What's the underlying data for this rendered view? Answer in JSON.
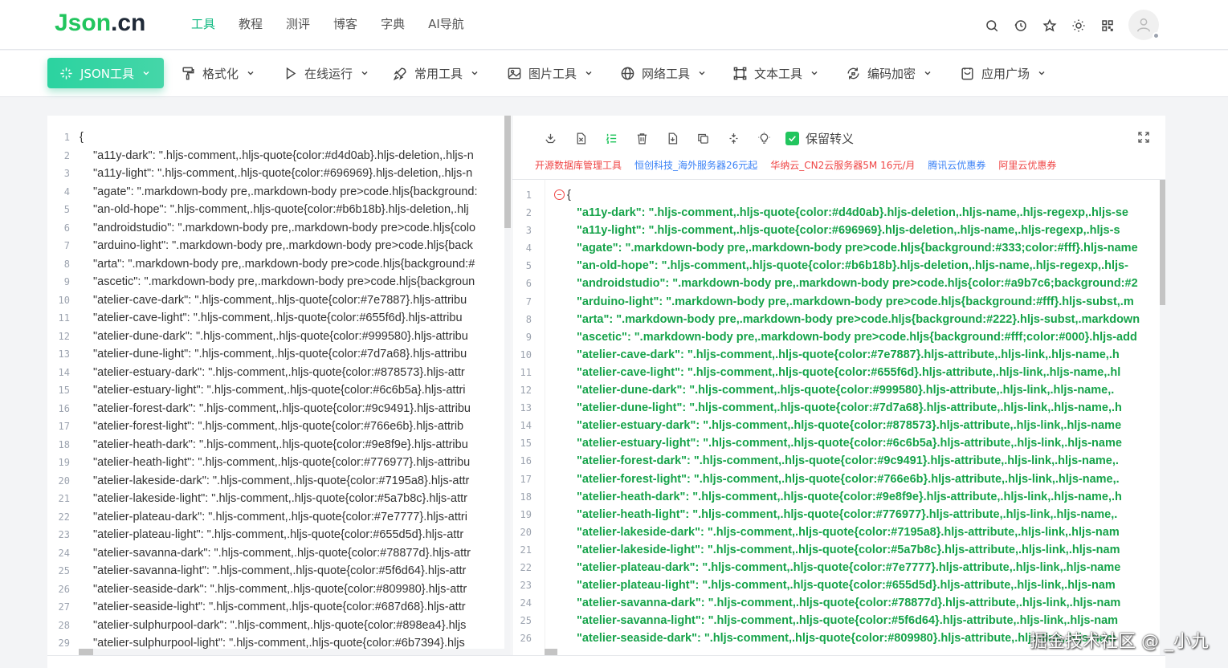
{
  "logo": {
    "part1": "Json",
    "part2": ".cn"
  },
  "nav": [
    {
      "label": "工具",
      "active": true
    },
    {
      "label": "教程",
      "active": false
    },
    {
      "label": "测评",
      "active": false
    },
    {
      "label": "博客",
      "active": false
    },
    {
      "label": "字典",
      "active": false
    },
    {
      "label": "AI导航",
      "active": false
    }
  ],
  "header_icons": [
    "search-icon",
    "history-icon",
    "star-icon",
    "sun-icon",
    "qrcode-icon"
  ],
  "toolbar": [
    {
      "label": "JSON工具",
      "icon": "sparkle-icon",
      "primary": true
    },
    {
      "label": "格式化",
      "icon": "paint-roller-icon"
    },
    {
      "label": "在线运行",
      "icon": "play-icon"
    },
    {
      "label": "常用工具",
      "icon": "rocket-icon"
    },
    {
      "label": "图片工具",
      "icon": "image-icon"
    },
    {
      "label": "网络工具",
      "icon": "globe-icon"
    },
    {
      "label": "文本工具",
      "icon": "frame-icon"
    },
    {
      "label": "编码加密",
      "icon": "refresh-lock-icon"
    },
    {
      "label": "应用广场",
      "icon": "app-icon"
    }
  ],
  "right_panel": {
    "keep_escape_label": "保留转义",
    "ads": [
      {
        "label": "开源数据库管理工具",
        "color": "red"
      },
      {
        "label": "恒创科技_海外服务器26元起",
        "color": "blue"
      },
      {
        "label": "华纳云_CN2云服务器5M 16元/月",
        "color": "red"
      },
      {
        "label": "腾讯云优惠券",
        "color": "blue"
      },
      {
        "label": "阿里云优惠券",
        "color": "red"
      }
    ]
  },
  "left_lines": [
    "{",
    "\"a11y-dark\": \".hljs-comment,.hljs-quote{color:#d4d0ab}.hljs-deletion,.hljs-n",
    "\"a11y-light\": \".hljs-comment,.hljs-quote{color:#696969}.hljs-deletion,.hljs-n",
    "\"agate\": \".markdown-body pre,.markdown-body pre>code.hljs{background:",
    "\"an-old-hope\": \".hljs-comment,.hljs-quote{color:#b6b18b}.hljs-deletion,.hlj",
    "\"androidstudio\": \".markdown-body pre,.markdown-body pre>code.hljs{colo",
    "\"arduino-light\": \".markdown-body pre,.markdown-body pre>code.hljs{back",
    "\"arta\": \".markdown-body pre,.markdown-body pre>code.hljs{background:#",
    "\"ascetic\": \".markdown-body pre,.markdown-body pre>code.hljs{backgroun",
    "\"atelier-cave-dark\": \".hljs-comment,.hljs-quote{color:#7e7887}.hljs-attribu",
    "\"atelier-cave-light\": \".hljs-comment,.hljs-quote{color:#655f6d}.hljs-attribu",
    "\"atelier-dune-dark\": \".hljs-comment,.hljs-quote{color:#999580}.hljs-attribu",
    "\"atelier-dune-light\": \".hljs-comment,.hljs-quote{color:#7d7a68}.hljs-attribu",
    "\"atelier-estuary-dark\": \".hljs-comment,.hljs-quote{color:#878573}.hljs-attr",
    "\"atelier-estuary-light\": \".hljs-comment,.hljs-quote{color:#6c6b5a}.hljs-attri",
    "\"atelier-forest-dark\": \".hljs-comment,.hljs-quote{color:#9c9491}.hljs-attribu",
    "\"atelier-forest-light\": \".hljs-comment,.hljs-quote{color:#766e6b}.hljs-attrib",
    "\"atelier-heath-dark\": \".hljs-comment,.hljs-quote{color:#9e8f9e}.hljs-attribu",
    "\"atelier-heath-light\": \".hljs-comment,.hljs-quote{color:#776977}.hljs-attribu",
    "\"atelier-lakeside-dark\": \".hljs-comment,.hljs-quote{color:#7195a8}.hljs-attr",
    "\"atelier-lakeside-light\": \".hljs-comment,.hljs-quote{color:#5a7b8c}.hljs-attr",
    "\"atelier-plateau-dark\": \".hljs-comment,.hljs-quote{color:#7e7777}.hljs-attri",
    "\"atelier-plateau-light\": \".hljs-comment,.hljs-quote{color:#655d5d}.hljs-attr",
    "\"atelier-savanna-dark\": \".hljs-comment,.hljs-quote{color:#78877d}.hljs-attr",
    "\"atelier-savanna-light\": \".hljs-comment,.hljs-quote{color:#5f6d64}.hljs-attr",
    "\"atelier-seaside-dark\": \".hljs-comment,.hljs-quote{color:#809980}.hljs-attr",
    "\"atelier-seaside-light\": \".hljs-comment,.hljs-quote{color:#687d68}.hljs-attr",
    "\"atelier-sulphurpool-dark\": \".hljs-comment,.hljs-quote{color:#898ea4}.hljs",
    "\"atelier-sulphurpool-light\": \".hljs-comment,.hljs-quote{color:#6b7394}.hljs"
  ],
  "right_lines": [
    {
      "key": "{",
      "val": ""
    },
    {
      "key": "\"a11y-dark\"",
      "val": "\".hljs-comment,.hljs-quote{color:#d4d0ab}.hljs-deletion,.hljs-name,.hljs-regexp,.hljs-se"
    },
    {
      "key": "\"a11y-light\"",
      "val": "\".hljs-comment,.hljs-quote{color:#696969}.hljs-deletion,.hljs-name,.hljs-regexp,.hljs-s"
    },
    {
      "key": "\"agate\"",
      "val": "\".markdown-body pre,.markdown-body pre>code.hljs{background:#333;color:#fff}.hljs-name"
    },
    {
      "key": "\"an-old-hope\"",
      "val": "\".hljs-comment,.hljs-quote{color:#b6b18b}.hljs-deletion,.hljs-name,.hljs-regexp,.hljs-"
    },
    {
      "key": "\"androidstudio\"",
      "val": "\".markdown-body pre,.markdown-body pre>code.hljs{color:#a9b7c6;background:#2"
    },
    {
      "key": "\"arduino-light\"",
      "val": "\".markdown-body pre,.markdown-body pre>code.hljs{background:#fff}.hljs-subst,.m"
    },
    {
      "key": "\"arta\"",
      "val": "\".markdown-body pre,.markdown-body pre>code.hljs{background:#222}.hljs-subst,.markdown"
    },
    {
      "key": "\"ascetic\"",
      "val": "\".markdown-body pre,.markdown-body pre>code.hljs{background:#fff;color:#000}.hljs-add"
    },
    {
      "key": "\"atelier-cave-dark\"",
      "val": "\".hljs-comment,.hljs-quote{color:#7e7887}.hljs-attribute,.hljs-link,.hljs-name,.h"
    },
    {
      "key": "\"atelier-cave-light\"",
      "val": "\".hljs-comment,.hljs-quote{color:#655f6d}.hljs-attribute,.hljs-link,.hljs-name,.hl"
    },
    {
      "key": "\"atelier-dune-dark\"",
      "val": "\".hljs-comment,.hljs-quote{color:#999580}.hljs-attribute,.hljs-link,.hljs-name,."
    },
    {
      "key": "\"atelier-dune-light\"",
      "val": "\".hljs-comment,.hljs-quote{color:#7d7a68}.hljs-attribute,.hljs-link,.hljs-name,.h"
    },
    {
      "key": "\"atelier-estuary-dark\"",
      "val": "\".hljs-comment,.hljs-quote{color:#878573}.hljs-attribute,.hljs-link,.hljs-name"
    },
    {
      "key": "\"atelier-estuary-light\"",
      "val": "\".hljs-comment,.hljs-quote{color:#6c6b5a}.hljs-attribute,.hljs-link,.hljs-name"
    },
    {
      "key": "\"atelier-forest-dark\"",
      "val": "\".hljs-comment,.hljs-quote{color:#9c9491}.hljs-attribute,.hljs-link,.hljs-name,."
    },
    {
      "key": "\"atelier-forest-light\"",
      "val": "\".hljs-comment,.hljs-quote{color:#766e6b}.hljs-attribute,.hljs-link,.hljs-name,."
    },
    {
      "key": "\"atelier-heath-dark\"",
      "val": "\".hljs-comment,.hljs-quote{color:#9e8f9e}.hljs-attribute,.hljs-link,.hljs-name,.h"
    },
    {
      "key": "\"atelier-heath-light\"",
      "val": "\".hljs-comment,.hljs-quote{color:#776977}.hljs-attribute,.hljs-link,.hljs-name,."
    },
    {
      "key": "\"atelier-lakeside-dark\"",
      "val": "\".hljs-comment,.hljs-quote{color:#7195a8}.hljs-attribute,.hljs-link,.hljs-nam"
    },
    {
      "key": "\"atelier-lakeside-light\"",
      "val": "\".hljs-comment,.hljs-quote{color:#5a7b8c}.hljs-attribute,.hljs-link,.hljs-nam"
    },
    {
      "key": "\"atelier-plateau-dark\"",
      "val": "\".hljs-comment,.hljs-quote{color:#7e7777}.hljs-attribute,.hljs-link,.hljs-name"
    },
    {
      "key": "\"atelier-plateau-light\"",
      "val": "\".hljs-comment,.hljs-quote{color:#655d5d}.hljs-attribute,.hljs-link,.hljs-nam"
    },
    {
      "key": "\"atelier-savanna-dark\"",
      "val": "\".hljs-comment,.hljs-quote{color:#78877d}.hljs-attribute,.hljs-link,.hljs-nam"
    },
    {
      "key": "\"atelier-savanna-light\"",
      "val": "\".hljs-comment,.hljs-quote{color:#5f6d64}.hljs-attribute,.hljs-link,.hljs-nam"
    },
    {
      "key": "\"atelier-seaside-dark\"",
      "val": "\".hljs-comment,.hljs-quote{color:#809980}.hljs-attribute,.hljs-link,.hljs-nam"
    }
  ],
  "watermark": "掘金技术社区 @ _小九",
  "colors": {
    "accent": "#10b981",
    "json_green": "#16a34a",
    "ad_red": "#ef4444",
    "ad_blue": "#3b82f6"
  }
}
